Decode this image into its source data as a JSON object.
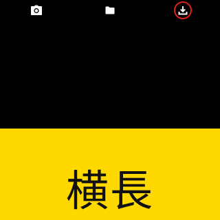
{
  "toolbar": {
    "buttons": [
      {
        "icon": "camera-icon"
      },
      {
        "icon": "folder-icon"
      },
      {
        "icon": "download-icon",
        "highlight_color": "#e01e1e"
      }
    ]
  },
  "colors": {
    "background": "#000000",
    "banner": "#ffd800",
    "icon": "#ffffff",
    "text": "#111111"
  },
  "banner": {
    "text": "横長"
  }
}
